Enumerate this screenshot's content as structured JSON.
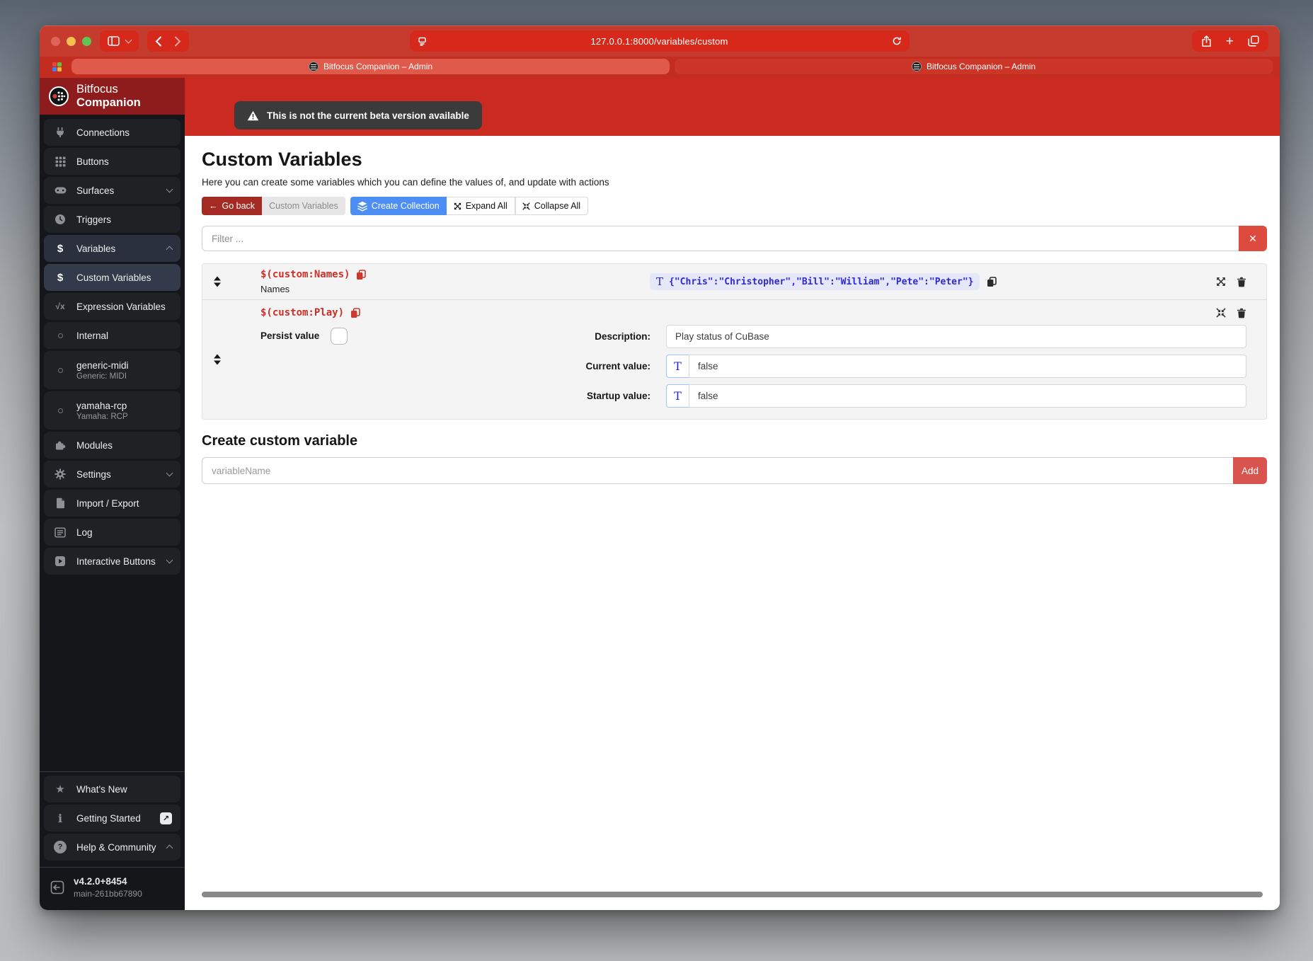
{
  "browser": {
    "url": "127.0.0.1:8000/variables/custom",
    "tabs": [
      {
        "title": "Bitfocus Companion – Admin"
      },
      {
        "title": "Bitfocus Companion – Admin"
      }
    ]
  },
  "banner": {
    "text": "This is not the current beta version available"
  },
  "sidebar": {
    "brand": {
      "first": "Bitfocus",
      "second": "Companion"
    },
    "items": [
      {
        "label": "Connections"
      },
      {
        "label": "Buttons"
      },
      {
        "label": "Surfaces"
      },
      {
        "label": "Triggers"
      },
      {
        "label": "Variables"
      },
      {
        "label": "Custom Variables"
      },
      {
        "label": "Expression Variables"
      },
      {
        "label": "Internal"
      },
      {
        "label": "generic-midi",
        "sublabel": "Generic: MIDI"
      },
      {
        "label": "yamaha-rcp",
        "sublabel": "Yamaha: RCP"
      },
      {
        "label": "Modules"
      },
      {
        "label": "Settings"
      },
      {
        "label": "Import / Export"
      },
      {
        "label": "Log"
      },
      {
        "label": "Interactive Buttons"
      },
      {
        "label": "What's New"
      },
      {
        "label": "Getting Started"
      },
      {
        "label": "Help & Community"
      }
    ],
    "footer": {
      "version": "v4.2.0+8454",
      "build": "main-261bb67890"
    }
  },
  "main": {
    "title": "Custom Variables",
    "subtitle": "Here you can create some variables which you can define the values of, and update with actions",
    "toolbar": {
      "go_back": "Go back",
      "current_page": "Custom Variables",
      "create_collection": "Create Collection",
      "expand_all": "Expand All",
      "collapse_all": "Collapse All"
    },
    "filter": {
      "placeholder": "Filter ..."
    },
    "variables": [
      {
        "name": "$(custom:Names)",
        "description": "Names",
        "value": "{\"Chris\":\"Christopher\",\"Bill\":\"William\",\"Pete\":\"Peter\"}"
      },
      {
        "name": "$(custom:Play)",
        "persist_label": "Persist value",
        "fields": [
          {
            "label": "Description:",
            "value": "Play status of CuBase"
          },
          {
            "label": "Current value:",
            "value": "false"
          },
          {
            "label": "Startup value:",
            "value": "false"
          }
        ]
      }
    ],
    "create": {
      "heading": "Create custom variable",
      "placeholder": "variableName",
      "add_label": "Add"
    }
  },
  "icons": {
    "dollar": "$",
    "sqrt": "√x",
    "star": "★",
    "info": "i",
    "question": "?",
    "external": "↗",
    "back_arrow": "←",
    "close": "✕",
    "plus": "+",
    "t": "T"
  },
  "colors": {
    "chrome_red": "#c53b2e",
    "banner_red": "#cb2a21",
    "accent_blue": "#4d8ef5",
    "variable_red": "#cb2f26",
    "value_blue": "#2b2bd0",
    "add_red": "#d9534f"
  }
}
